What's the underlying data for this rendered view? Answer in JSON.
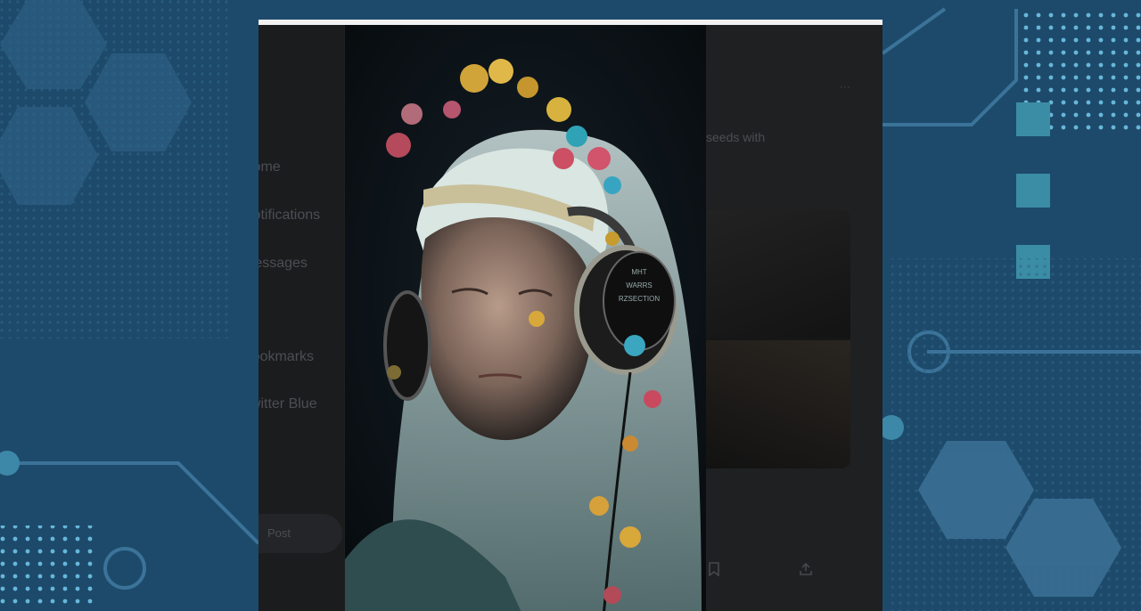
{
  "background": {
    "accent": "#6fc3e6",
    "base": "#1d4a6b"
  },
  "sidebar": {
    "items": [
      {
        "label": "Home"
      },
      {
        "label": "Notifications"
      },
      {
        "label": "Messages"
      },
      {
        "label": ""
      },
      {
        "label": "Bookmarks"
      },
      {
        "label": "Twitter Blue"
      }
    ],
    "button_label": "Post"
  },
  "right_panel": {
    "menu_icon": "more-icon",
    "text": "seeds with"
  },
  "actions": {
    "bookmark_icon": "bookmark-icon",
    "share_icon": "share-icon"
  },
  "photo": {
    "headphone_text": [
      "MHT",
      "WARRS",
      "RZSECTION"
    ]
  }
}
